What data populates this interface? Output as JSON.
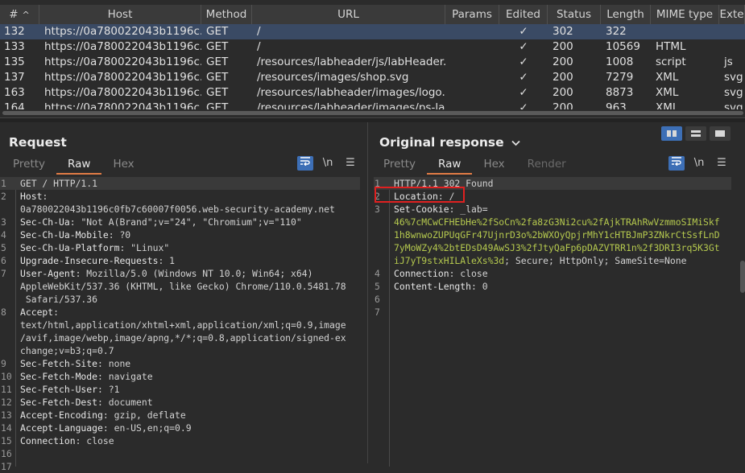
{
  "table": {
    "columns": [
      {
        "label": "#",
        "name": "col-number"
      },
      {
        "label": "Host",
        "name": "col-host"
      },
      {
        "label": "Method",
        "name": "col-method"
      },
      {
        "label": "URL",
        "name": "col-url"
      },
      {
        "label": "Params",
        "name": "col-params"
      },
      {
        "label": "Edited",
        "name": "col-edited"
      },
      {
        "label": "Status",
        "name": "col-status"
      },
      {
        "label": "Length",
        "name": "col-length"
      },
      {
        "label": "MIME type",
        "name": "col-mime"
      },
      {
        "label": "Exte",
        "name": "col-extension"
      }
    ],
    "sort_indicator": "^",
    "rows": [
      {
        "num": "132",
        "host": "https://0a780022043b1196c...",
        "method": "GET",
        "url": "/",
        "params": "",
        "edited": "✓",
        "status": "302",
        "length": "322",
        "mime": "",
        "ext": "",
        "selected": true
      },
      {
        "num": "133",
        "host": "https://0a780022043b1196c...",
        "method": "GET",
        "url": "/",
        "params": "",
        "edited": "✓",
        "status": "200",
        "length": "10569",
        "mime": "HTML",
        "ext": ""
      },
      {
        "num": "135",
        "host": "https://0a780022043b1196c...",
        "method": "GET",
        "url": "/resources/labheader/js/labHeader.js",
        "params": "",
        "edited": "✓",
        "status": "200",
        "length": "1008",
        "mime": "script",
        "ext": "js"
      },
      {
        "num": "137",
        "host": "https://0a780022043b1196c...",
        "method": "GET",
        "url": "/resources/images/shop.svg",
        "params": "",
        "edited": "✓",
        "status": "200",
        "length": "7279",
        "mime": "XML",
        "ext": "svg"
      },
      {
        "num": "163",
        "host": "https://0a780022043b1196c...",
        "method": "GET",
        "url": "/resources/labheader/images/logo...",
        "params": "",
        "edited": "✓",
        "status": "200",
        "length": "8873",
        "mime": "XML",
        "ext": "svg"
      },
      {
        "num": "164",
        "host": "https://0a780022043b1196c...",
        "method": "GET",
        "url": "/resources/labheader/images/ps-la...",
        "params": "",
        "edited": "✓",
        "status": "200",
        "length": "963",
        "mime": "XML",
        "ext": "svg"
      }
    ]
  },
  "request": {
    "title": "Request",
    "tabs": [
      "Pretty",
      "Raw",
      "Hex"
    ],
    "active_tab": "Raw",
    "newline_label": "\\n",
    "lines": [
      {
        "n": "1",
        "parts": [
          [
            "plain",
            "GET / HTTP/1.1"
          ]
        ]
      },
      {
        "n": "2",
        "parts": [
          [
            "key",
            "Host"
          ],
          [
            "plain",
            ":"
          ]
        ]
      },
      {
        "n": "",
        "parts": [
          [
            "plain",
            "0a780022043b1196c0fb7c60007f0056.web-security-academy.net"
          ]
        ]
      },
      {
        "n": "3",
        "parts": [
          [
            "key",
            "Sec-Ch-Ua"
          ],
          [
            "plain",
            ": \"Not A(Brand\";v=\"24\", \"Chromium\";v=\"110\""
          ]
        ]
      },
      {
        "n": "4",
        "parts": [
          [
            "key",
            "Sec-Ch-Ua-Mobile"
          ],
          [
            "plain",
            ": ?0"
          ]
        ]
      },
      {
        "n": "5",
        "parts": [
          [
            "key",
            "Sec-Ch-Ua-Platform"
          ],
          [
            "plain",
            ": \"Linux\""
          ]
        ]
      },
      {
        "n": "6",
        "parts": [
          [
            "key",
            "Upgrade-Insecure-Requests"
          ],
          [
            "plain",
            ": 1"
          ]
        ]
      },
      {
        "n": "7",
        "parts": [
          [
            "key",
            "User-Agent"
          ],
          [
            "plain",
            ": Mozilla/5.0 (Windows NT 10.0; Win64; x64)"
          ]
        ]
      },
      {
        "n": "",
        "parts": [
          [
            "plain",
            "AppleWebKit/537.36 (KHTML, like Gecko) Chrome/110.0.5481.78"
          ]
        ]
      },
      {
        "n": "",
        "parts": [
          [
            "plain",
            " Safari/537.36"
          ]
        ]
      },
      {
        "n": "8",
        "parts": [
          [
            "key",
            "Accept"
          ],
          [
            "plain",
            ":"
          ]
        ]
      },
      {
        "n": "",
        "parts": [
          [
            "plain",
            "text/html,application/xhtml+xml,application/xml;q=0.9,image"
          ]
        ]
      },
      {
        "n": "",
        "parts": [
          [
            "plain",
            "/avif,image/webp,image/apng,*/*;q=0.8,application/signed-ex"
          ]
        ]
      },
      {
        "n": "",
        "parts": [
          [
            "plain",
            "change;v=b3;q=0.7"
          ]
        ]
      },
      {
        "n": "9",
        "parts": [
          [
            "key",
            "Sec-Fetch-Site"
          ],
          [
            "plain",
            ": none"
          ]
        ]
      },
      {
        "n": "10",
        "parts": [
          [
            "key",
            "Sec-Fetch-Mode"
          ],
          [
            "plain",
            ": navigate"
          ]
        ]
      },
      {
        "n": "11",
        "parts": [
          [
            "key",
            "Sec-Fetch-User"
          ],
          [
            "plain",
            ": ?1"
          ]
        ]
      },
      {
        "n": "12",
        "parts": [
          [
            "key",
            "Sec-Fetch-Dest"
          ],
          [
            "plain",
            ": document"
          ]
        ]
      },
      {
        "n": "13",
        "parts": [
          [
            "key",
            "Accept-Encoding"
          ],
          [
            "plain",
            ": gzip, deflate"
          ]
        ]
      },
      {
        "n": "14",
        "parts": [
          [
            "key",
            "Accept-Language"
          ],
          [
            "plain",
            ": en-US,en;q=0.9"
          ]
        ]
      },
      {
        "n": "15",
        "parts": [
          [
            "key",
            "Connection"
          ],
          [
            "plain",
            ": close"
          ]
        ]
      },
      {
        "n": "16",
        "parts": [
          [
            "plain",
            ""
          ]
        ]
      },
      {
        "n": "17",
        "parts": [
          [
            "plain",
            ""
          ]
        ]
      }
    ]
  },
  "response": {
    "title": "Original response",
    "tabs": [
      "Pretty",
      "Raw",
      "Hex",
      "Render"
    ],
    "active_tab": "Raw",
    "newline_label": "\\n",
    "lines": [
      {
        "n": "1",
        "parts": [
          [
            "plain",
            "HTTP/1.1 302 Found"
          ]
        ]
      },
      {
        "n": "2",
        "parts": [
          [
            "key",
            "Location"
          ],
          [
            "plain",
            ": /"
          ]
        ]
      },
      {
        "n": "3",
        "parts": [
          [
            "key",
            "Set-Cookie"
          ],
          [
            "plain",
            ": _lab="
          ]
        ]
      },
      {
        "n": "",
        "parts": [
          [
            "green",
            "46%7cMCwCFHEbHe%2fSoCn%2fa8zG3Ni2cu%2fAjkTRAhRwVzmmoSIMiSkf"
          ]
        ]
      },
      {
        "n": "",
        "parts": [
          [
            "green",
            "1h8wnwoZUPUqGFr47UjnrD3o%2bWXOyQpjrMhY1cHTBJmP3ZNkrCtSsfLnD"
          ]
        ]
      },
      {
        "n": "",
        "parts": [
          [
            "green",
            "7yMoWZy4%2btEDsD49AwSJ3%2fJtyQaFp6pDAZVTRR1n%2f3DRI3rq5K3Gt"
          ]
        ]
      },
      {
        "n": "",
        "parts": [
          [
            "green",
            "iJ7yT9stxHILAleXs%3d"
          ],
          [
            "plain",
            "; Secure; HttpOnly; SameSite=None"
          ]
        ]
      },
      {
        "n": "4",
        "parts": [
          [
            "key",
            "Connection"
          ],
          [
            "plain",
            ": close"
          ]
        ]
      },
      {
        "n": "5",
        "parts": [
          [
            "key",
            "Content-Length"
          ],
          [
            "plain",
            ": 0"
          ]
        ]
      },
      {
        "n": "6",
        "parts": [
          [
            "plain",
            ""
          ]
        ]
      },
      {
        "n": "7",
        "parts": [
          [
            "plain",
            ""
          ]
        ]
      }
    ]
  }
}
